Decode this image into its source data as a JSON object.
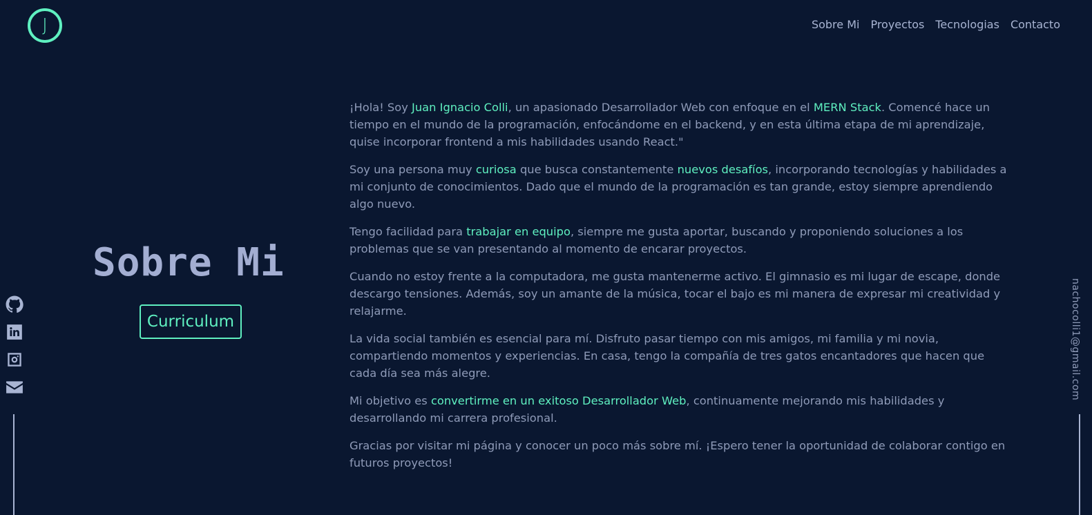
{
  "header": {
    "logo_letter": "J",
    "nav": [
      "Sobre Mi",
      "Proyectos",
      "Tecnologias",
      "Contacto"
    ]
  },
  "hero": {
    "title": "Sobre Mi",
    "button_label": "Curriculum"
  },
  "about": {
    "p1": [
      {
        "t": "¡Hola! Soy ",
        "h": false
      },
      {
        "t": "Juan Ignacio Colli",
        "h": true
      },
      {
        "t": ", un apasionado Desarrollador Web con enfoque en el ",
        "h": false
      },
      {
        "t": "MERN Stack",
        "h": true
      },
      {
        "t": ". Comencé hace un tiempo en el mundo de la programación, enfocándome en el backend, y en esta última etapa de mi aprendizaje, quise incorporar frontend a mis habilidades usando React.\"",
        "h": false
      }
    ],
    "p2": [
      {
        "t": "Soy una persona muy ",
        "h": false
      },
      {
        "t": "curiosa",
        "h": true
      },
      {
        "t": " que busca constantemente ",
        "h": false
      },
      {
        "t": "nuevos desafíos",
        "h": true
      },
      {
        "t": ", incorporando tecnologías y habilidades a mi conjunto de conocimientos. Dado que el mundo de la programación es tan grande, estoy siempre aprendiendo algo nuevo.",
        "h": false
      }
    ],
    "p3": [
      {
        "t": "Tengo facilidad para ",
        "h": false
      },
      {
        "t": "trabajar en equipo",
        "h": true
      },
      {
        "t": ", siempre me gusta aportar, buscando y proponiendo soluciones a los problemas que se van presentando al momento de encarar proyectos.",
        "h": false
      }
    ],
    "p4": [
      {
        "t": "Cuando no estoy frente a la computadora, me gusta mantenerme activo. El gimnasio es mi lugar de escape, donde descargo tensiones. Además, soy un amante de la música, tocar el bajo es mi manera de expresar mi creatividad y relajarme.",
        "h": false
      }
    ],
    "p5": [
      {
        "t": "La vida social también es esencial para mí. Disfruto pasar tiempo con mis amigos, mi familia y mi novia, compartiendo momentos y experiencias. En casa, tengo la compañía de tres gatos encantadores que hacen que cada día sea más alegre.",
        "h": false
      }
    ],
    "p6": [
      {
        "t": "Mi objetivo es ",
        "h": false
      },
      {
        "t": "convertirme en un exitoso Desarrollador Web",
        "h": true
      },
      {
        "t": ", continuamente mejorando mis habilidades y desarrollando mi carrera profesional.",
        "h": false
      }
    ],
    "p7": [
      {
        "t": "Gracias por visitar mi página y conocer un poco más sobre mí. ¡Espero tener la oportunidad de colaborar contigo en futuros proyectos!",
        "h": false
      }
    ]
  },
  "social": {
    "icons": [
      "github-icon",
      "linkedin-icon",
      "instagram-icon",
      "envelope-icon"
    ]
  },
  "email": "nachocolli1@gmail.com",
  "colors": {
    "background": "#0a1730",
    "accent": "#5ff0c0",
    "text": "#8f9bb8",
    "heading": "#a3aed2"
  }
}
